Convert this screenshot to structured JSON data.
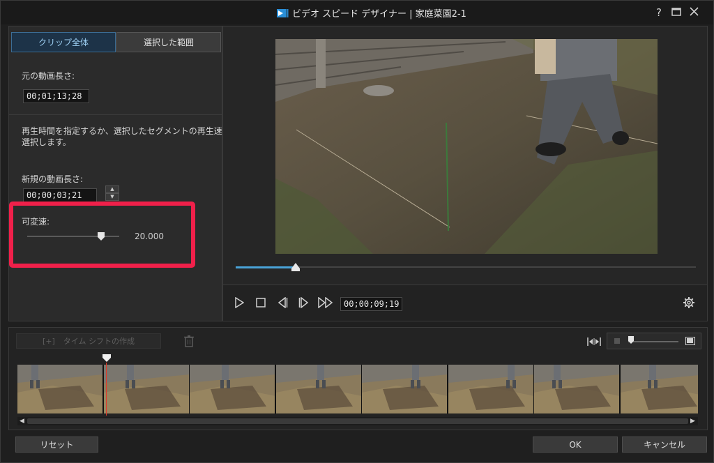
{
  "titlebar": {
    "title": "ビデオ スピード デザイナー  |  家庭菜園2-1",
    "help_label": "?",
    "maximize_label": "☐",
    "close_label": "✕"
  },
  "tabs": [
    {
      "label": "クリップ全体",
      "active": true
    },
    {
      "label": "選択した範囲",
      "active": false
    }
  ],
  "left_panel": {
    "original_length_label": "元の動画長さ:",
    "original_length_value": "00;01;13;28",
    "instruction_line1": "再生時間を指定するか、選択したセグメントの再生速度を",
    "instruction_line2": "選択します。",
    "new_length_label": "新規の動画長さ:",
    "new_length_value": "00;00;03;21",
    "variable_speed_label": "可変速:",
    "variable_speed_value": "20.000",
    "variable_speed_slider_fraction": 0.8
  },
  "preview": {
    "seek_fraction": 0.13,
    "current_time": "00;00;09;19"
  },
  "timeline": {
    "timeshift_label": "タイム シフトの作成",
    "timeshift_icon": "[+]",
    "frame_count": 8
  },
  "buttons": {
    "reset": "リセット",
    "ok": "OK",
    "cancel": "キャンセル"
  },
  "colors": {
    "accent_blue": "#4aa3d8",
    "highlight_red": "#f0204a",
    "playhead_red": "#e03a2a"
  }
}
